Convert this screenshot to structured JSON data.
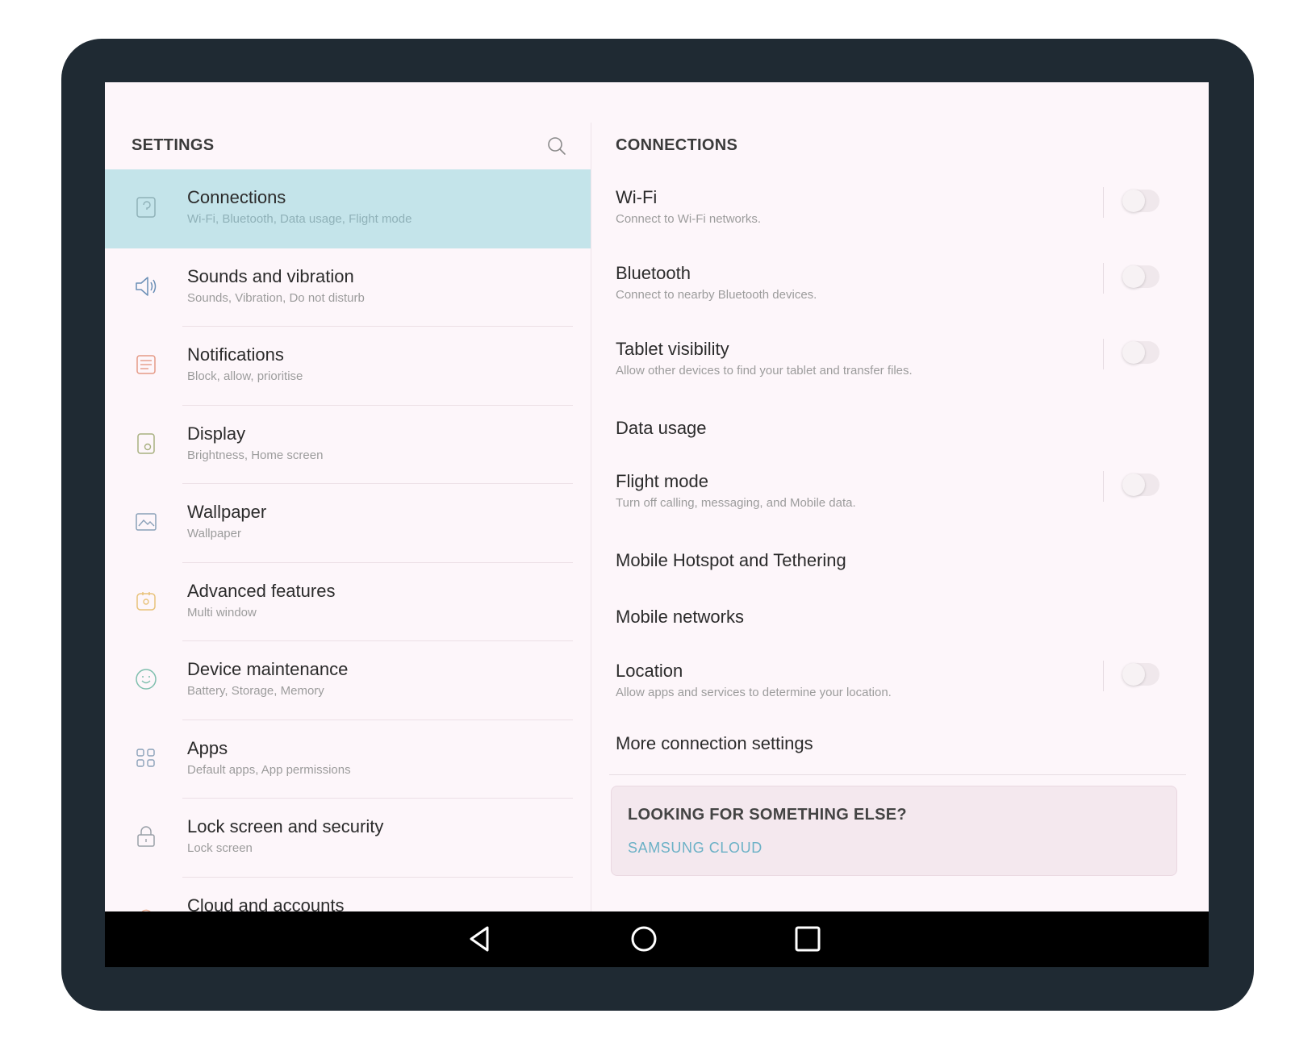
{
  "left_panel": {
    "title": "SETTINGS",
    "items": [
      {
        "title": "Connections",
        "subtitle": "Wi-Fi, Bluetooth, Data usage, Flight mode",
        "icon": "connections-icon"
      },
      {
        "title": "Sounds and vibration",
        "subtitle": "Sounds, Vibration, Do not disturb",
        "icon": "speaker-icon"
      },
      {
        "title": "Notifications",
        "subtitle": "Block, allow, prioritise",
        "icon": "notifications-icon"
      },
      {
        "title": "Display",
        "subtitle": "Brightness, Home screen",
        "icon": "display-icon"
      },
      {
        "title": "Wallpaper",
        "subtitle": "Wallpaper",
        "icon": "wallpaper-icon"
      },
      {
        "title": "Advanced features",
        "subtitle": "Multi window",
        "icon": "advanced-features-icon"
      },
      {
        "title": "Device maintenance",
        "subtitle": "Battery, Storage, Memory",
        "icon": "device-maintenance-icon"
      },
      {
        "title": "Apps",
        "subtitle": "Default apps, App permissions",
        "icon": "apps-grid-icon"
      },
      {
        "title": "Lock screen and security",
        "subtitle": "Lock screen",
        "icon": "lock-icon"
      },
      {
        "title": "Cloud and accounts",
        "subtitle": "",
        "icon": "cloud-icon"
      }
    ]
  },
  "right_panel": {
    "title": "CONNECTIONS",
    "items": [
      {
        "title": "Wi-Fi",
        "subtitle": "Connect to Wi-Fi networks.",
        "toggle": "off"
      },
      {
        "title": "Bluetooth",
        "subtitle": "Connect to nearby Bluetooth devices.",
        "toggle": "off"
      },
      {
        "title": "Tablet visibility",
        "subtitle": "Allow other devices to find your tablet and transfer files.",
        "toggle": "off"
      },
      {
        "title": "Data usage"
      },
      {
        "title": "Flight mode",
        "subtitle": "Turn off calling, messaging, and Mobile data.",
        "toggle": "off"
      },
      {
        "title": "Mobile Hotspot and Tethering"
      },
      {
        "title": "Mobile networks"
      },
      {
        "title": "Location",
        "subtitle": "Allow apps and services to determine your location.",
        "toggle": "off"
      },
      {
        "title": "More connection settings"
      }
    ],
    "card": {
      "title": "LOOKING FOR SOMETHING ELSE?",
      "link": "SAMSUNG CLOUD"
    }
  },
  "colors": {
    "selected_row": "#c4e4ea",
    "link": "#6bb1c6",
    "bezel": "#1f2a33"
  },
  "navbar": {
    "buttons": [
      "back-icon",
      "home-icon",
      "recents-icon"
    ]
  }
}
